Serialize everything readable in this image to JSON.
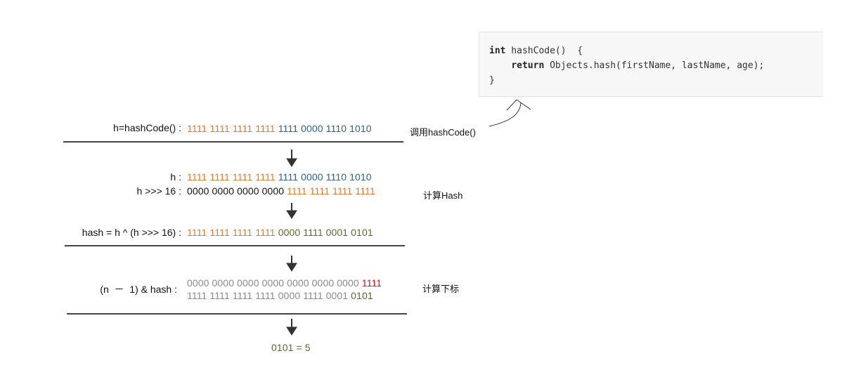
{
  "colors": {
    "orange": "#e07a2a",
    "blue": "#2f5f8a",
    "olive": "#5f6a20",
    "red": "#e01010",
    "gray": "#8a8a8a",
    "dark": "#111111"
  },
  "code": {
    "line1_kw": "int",
    "line1_rest": " hashCode()  {",
    "line2_kw": "return",
    "line2_rest": " Objects.hash(firstName, lastName, age);",
    "line3": "}"
  },
  "rows": {
    "r1_label": "h=hashCode() :",
    "r1_bits_a": "1111 1111 1111 1111",
    "r1_bits_b": "1111 0000 1110 1010",
    "r2_label": "h :",
    "r2_bits_a": "1111 1111 1111 1111",
    "r2_bits_b": "1111 0000 1110 1010",
    "r3_label": "h >>> 16 :",
    "r3_bits_a": "0000 0000 0000 0000",
    "r3_bits_b": "1111 1111 1111 1111",
    "r4_label": "hash = h ^ (h >>> 16) :",
    "r4_bits_a": "1111 1111 1111 1111",
    "r4_bits_b": "0000 1111 0001 0101",
    "r5_label": "(n  －  1) & hash :",
    "r5_bits_a": "0000 0000 0000 0000 0000 0000 0000",
    "r5_bits_b": "1111",
    "r6_bits_a": "1111 1111 1111 1111 0000 1111 0001",
    "r6_bits_b": "0101",
    "result": "0101 = 5"
  },
  "side": {
    "call": "调用hashCode()",
    "compute_hash": "计算Hash",
    "compute_index": "计算下标"
  }
}
